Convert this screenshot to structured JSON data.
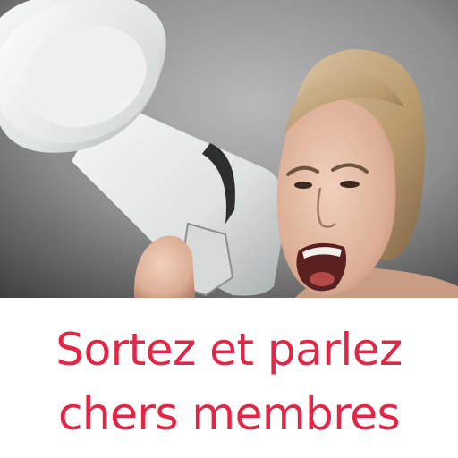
{
  "caption": {
    "line1": "Sortez et parlez",
    "line2": "chers membres"
  },
  "colors": {
    "caption_text": "#e32645",
    "background": "#ffffff",
    "photo_backdrop": "#8f8f8f",
    "megaphone": "#e9eceb"
  },
  "image": {
    "subject": "woman-shouting-into-megaphone"
  }
}
